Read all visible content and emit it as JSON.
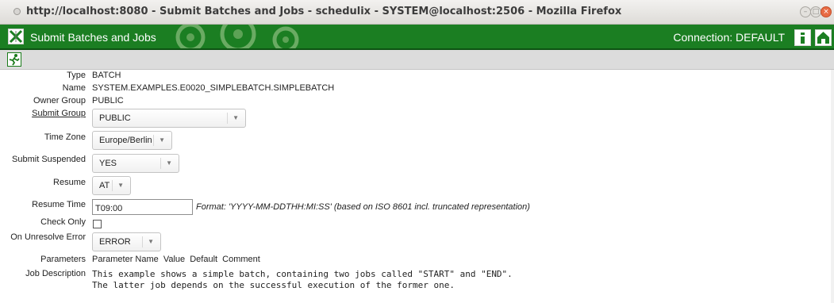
{
  "window": {
    "title": "http://localhost:8080 - Submit Batches and Jobs - schedulix - SYSTEM@localhost:2506 - Mozilla Firefox"
  },
  "app": {
    "title": "Submit Batches and Jobs",
    "connection_label": "Connection:",
    "connection_value": "DEFAULT",
    "info_icon": "info-icon",
    "home_icon": "home-icon",
    "brand_color": "#1b7e22"
  },
  "toolbar": {
    "submit_icon": "run-submit-icon"
  },
  "form": {
    "type": {
      "label": "Type",
      "value": "BATCH"
    },
    "name": {
      "label": "Name",
      "value": "SYSTEM.EXAMPLES.E0020_SIMPLEBATCH.SIMPLEBATCH"
    },
    "owner_group": {
      "label": "Owner Group",
      "value": "PUBLIC"
    },
    "submit_group": {
      "label": "Submit Group",
      "value": "PUBLIC"
    },
    "time_zone": {
      "label": "Time Zone",
      "value": "Europe/Berlin"
    },
    "submit_suspended": {
      "label": "Submit Suspended",
      "value": "YES"
    },
    "resume": {
      "label": "Resume",
      "value": "AT"
    },
    "resume_time": {
      "label": "Resume Time",
      "value": "T09:00",
      "hint": "Format: 'YYYY-MM-DDTHH:MI:SS' (based on ISO 8601 incl. truncated representation)"
    },
    "check_only": {
      "label": "Check Only",
      "checked": false
    },
    "on_unresolve_error": {
      "label": "On Unresolve Error",
      "value": "ERROR"
    },
    "parameters": {
      "label": "Parameters",
      "columns": [
        "Parameter Name",
        "Value",
        "Default",
        "Comment"
      ]
    },
    "job_description": {
      "label": "Job Description",
      "lines": [
        "This example shows a simple batch, containing two jobs called \"START\" and \"END\".",
        "The latter job depends on the successful execution of the former one."
      ]
    }
  }
}
